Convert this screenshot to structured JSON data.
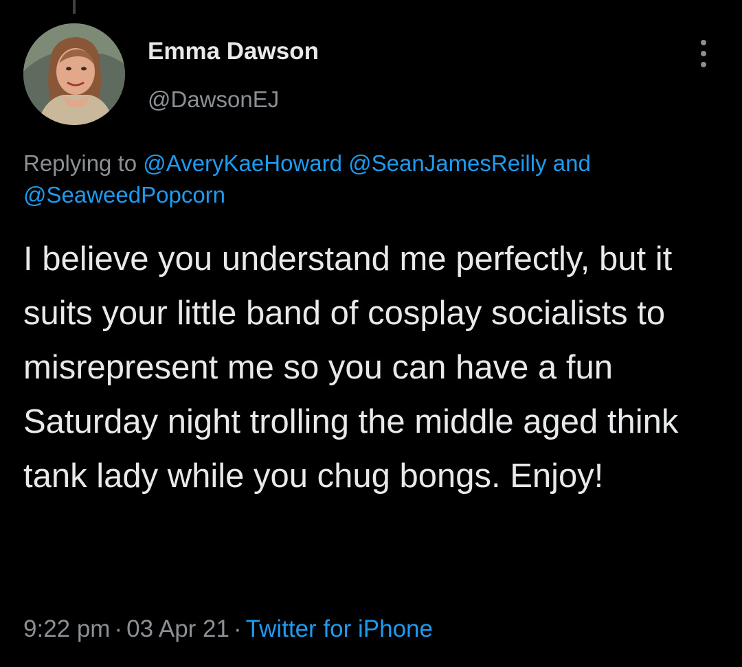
{
  "tweet": {
    "author": {
      "name": "Emma Dawson",
      "handle": "@DawsonEJ"
    },
    "reply_context": {
      "prefix": "Replying to",
      "mentions": [
        "@AveryKaeHoward",
        "@SeanJamesReilly",
        "@SeaweedPopcorn"
      ],
      "joiner": "and"
    },
    "text": "I believe you understand me perfectly, but it suits your little band of cosplay socialists to misrepresent me so you can have a fun Saturday night trolling the middle aged think tank lady while you chug bongs. Enjoy!",
    "time": "9:22 pm",
    "date": "03 Apr 21",
    "source": "Twitter for iPhone",
    "separator": "·"
  },
  "icons": {
    "more": "more-vertical-icon"
  },
  "colors": {
    "background": "#000000",
    "primary_text": "#e7e9ea",
    "secondary_text": "#8b9094",
    "link": "#1d9bf0"
  }
}
